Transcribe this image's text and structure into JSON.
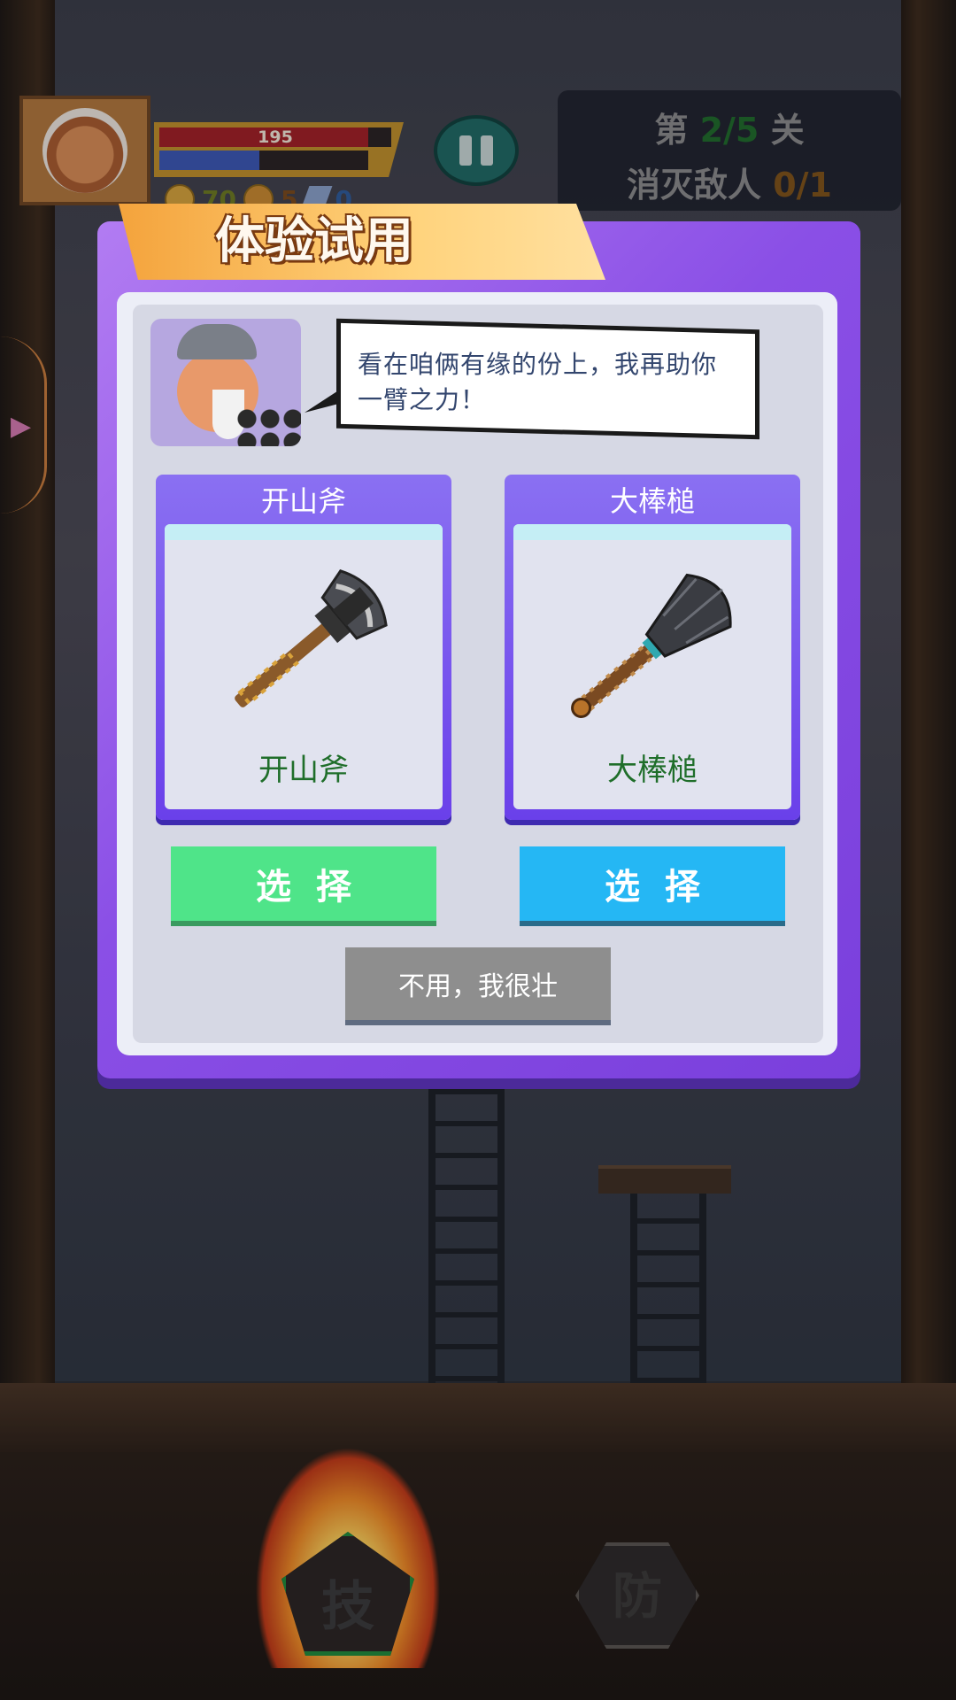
{
  "hud": {
    "hp_value": "195",
    "hp_ratio": 0.9,
    "mp_ratio": 0.48,
    "resources": [
      "70",
      "5",
      "0"
    ],
    "level": {
      "prefix": "第",
      "current": "2/5",
      "suffix": "关",
      "enemies_label": "消灭敌人",
      "enemies_count": "0/1"
    }
  },
  "dialog": {
    "title": "体验试用",
    "npc_speech": "看在咱俩有缘的份上，我再助你一臂之力！",
    "weapons": [
      {
        "header": "开山斧",
        "name": "开山斧",
        "icon": "axe-icon"
      },
      {
        "header": "大棒槌",
        "name": "大棒槌",
        "icon": "club-icon"
      }
    ],
    "choose_label": "选择",
    "decline_label": "不用，我很壮"
  },
  "skills": {
    "attack_label": "技",
    "defend_label": "防"
  },
  "colors": {
    "modal_purple": "#8a4fe6",
    "choose_green": "#4fe489",
    "choose_blue": "#25b7f4",
    "decline_gray": "#8e8e8e",
    "weapon_name_green": "#1f6e2a"
  }
}
